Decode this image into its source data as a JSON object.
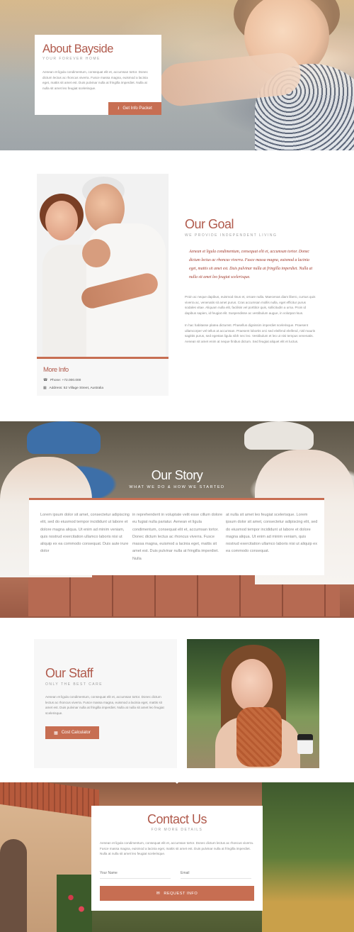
{
  "about": {
    "title": "About Bayside",
    "subtitle": "YOUR FOREVER HOME",
    "body": "Aenean et ligula condimentum, consequat elit et, accumsan tortor. Donec dictum lectus ac rhoncus viverra. Fusce massa magna, euismod a lacinia eget, mattis sit amet est. Duis pulvinar nulla at fringilla imperdiet. Nulla at nulla sit amet leo feugiat scelerisque.",
    "button_label": "Get Info Packet",
    "button_icon": "download-icon"
  },
  "goal": {
    "title": "Our Goal",
    "subtitle": "WE PROVIDE INDEPENDENT LIVING",
    "quote": "Aenean et ligula condimentum, consequat elit et, accumsan tortor. Donec dictum lectus ac rhoncus viverra. Fusce massa magna, euismod a lacinia eget, mattis sit amet est. Duis pulvinar nulla at fringilla imperdiet. Nulla at nulla sit amet leo feugiat scelerisque.",
    "para1": "Proin ac neque dapibus, euismod risus et, ornare nulla. Maecenas diam libero, cursus quis viverra ac, venenatis sit amet purus. Cras accumsan mollis nulla, eget efficitur purus sodales vitae. Aliquam nulla elit, facilisis vel porttitor quis, sollicitudin a urna. Proin id dapibus sapien, id feugiat elit. Suspendisse ac vestibulum augue, in volutpat risus.",
    "para2": "In hac habitasse platea dictumst. Phasellus dignissim imperdiet scelerisque. Praesent ullamcorper vel tellus at accumsan. Praesent lobortis orci sed eleifend eleifend, nisl mauris sagittis purus, sed egestas ligula nibh nec leo. Vestibulum et leo ut nisi tempus venenatis. Aenean sit amet enim at neque finibus dictum. Sed feugiat aliquet elit et luctus."
  },
  "more_info": {
    "title": "More Info",
    "phone": "Phone: +72.000.000",
    "address": "Address: 52 Village Street, Australia",
    "phone_icon": "phone-icon",
    "address_icon": "building-icon"
  },
  "story": {
    "title": "Our Story",
    "subtitle": "WHAT WE DO & HOW WE STARTED",
    "col1": "Lorem ipsum dolor sit amet, consectetur adipiscing elit, sed do eiusmod tempor incididunt ut labore et dolore magna aliqua. Ut enim ad minim veniam, quis nostrud exercitation ullamco laboris nisi ut aliquip ex ea commodo consequat. Duis aute irure dolor",
    "col2": "in reprehenderit in voluptate velit esse cillum dolore eu fugiat nulla pariatur. Aenean et ligula condimentum, consequat elit et, accumsan tortor. Donec dictum lectus ac rhoncus viverra. Fusce massa magna, euismod a lacinia eget, mattis sit amet est. Duis pulvinar nulla at fringilla imperdiet. Nulla",
    "col3": "at nulla sit amet leo feugiat scelerisque. Lorem ipsum dolor sit amet, consectetur adipiscing elit, sed do eiusmod tempor incididunt ut labore et dolore magna aliqua. Ut enim ad minim veniam, quis nostrud exercitation ullamco laboris nisi ut aliquip ex ea commodo consequat."
  },
  "staff": {
    "title": "Our Staff",
    "subtitle": "ONLY THE BEST CARE",
    "body": "Aenean et ligula condimentum, consequat elit et, accumsan tortor. Donec dictum lectus ac rhoncus viverra. Fusce massa magna, euismod a lacinia eget, mattis sit amet est. Duis pulvinar nulla at fringilla imperdiet. Nulla at nulla sit amet leo feugiat scelerisque.",
    "button_label": "Cost Calculator",
    "button_icon": "calculator-icon"
  },
  "contact": {
    "title": "Contact Us",
    "subtitle": "FOR MORE DETAILS",
    "body": "Aenean et ligula condimentum, consequat elit et, accumsan tortor. Donec dictum lectus ac rhoncus viverra. Fusce massa magna, euismod a lacinia eget, mattis sit amet est. Duis pulvinar nulla at fringilla imperdiet. Nulla at nulla sit amet leo feugiat scelerisque.",
    "name_placeholder": "Your Name",
    "email_placeholder": "Email",
    "button_label": "REQUEST INFO",
    "button_icon": "envelope-icon"
  },
  "colors": {
    "accent": "#c76e52",
    "heading": "#b05a4c",
    "quote": "#a03a2c",
    "panel": "#f7f7f7"
  }
}
